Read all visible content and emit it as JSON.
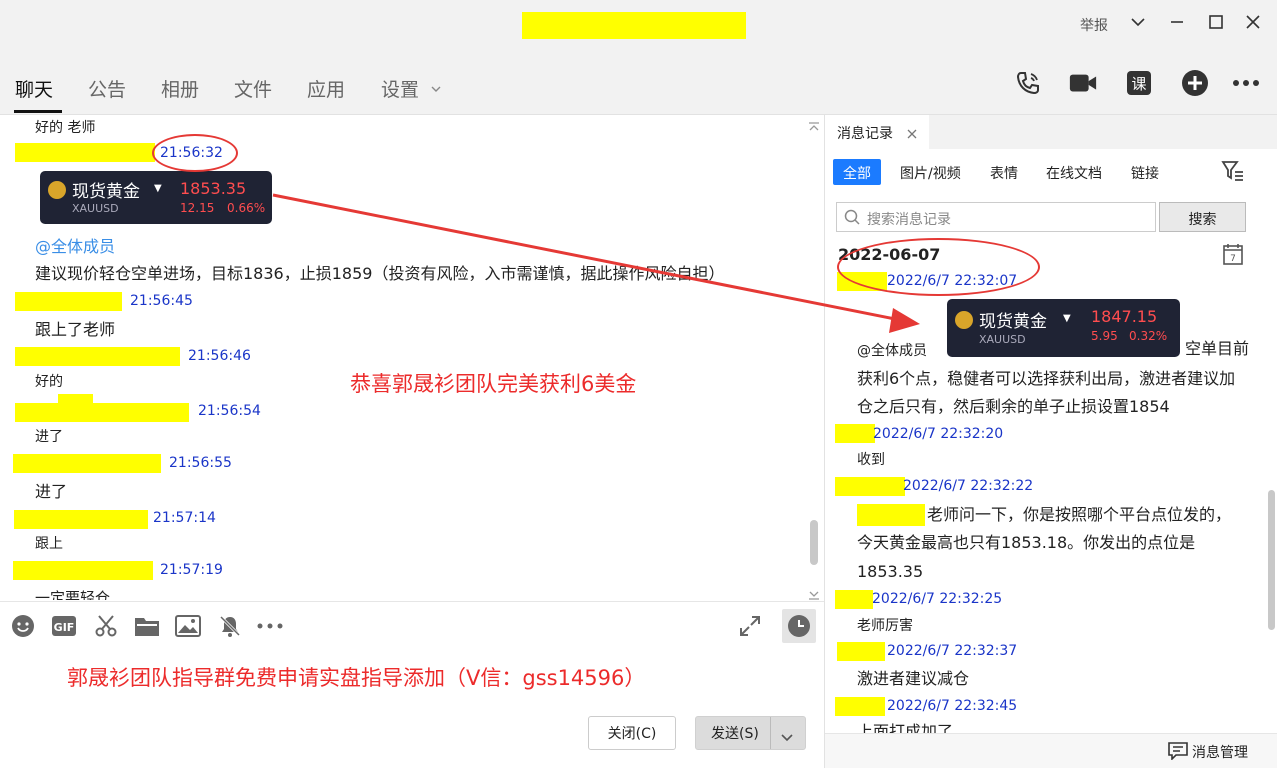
{
  "window": {
    "report_label": "举报"
  },
  "tabs": [
    {
      "label": "聊天"
    },
    {
      "label": "公告"
    },
    {
      "label": "相册"
    },
    {
      "label": "文件"
    },
    {
      "label": "应用"
    },
    {
      "label": "设置"
    }
  ],
  "toolbar": {
    "course_label": "课"
  },
  "chat": {
    "messages": [
      {
        "text": "好的  老师",
        "time": "21:56:32"
      },
      {
        "at": "@全体成员",
        "text": " 建议现价轻仓空单进场，目标1836，止损1859（投资有风险，入市需谨慎，据此操作风险自担）",
        "time": "21:56:45"
      },
      {
        "text": "跟上了老师",
        "time": "21:56:46"
      },
      {
        "text": "好的",
        "time": "21:56:54"
      },
      {
        "text": "进了",
        "time": "21:56:55"
      },
      {
        "text": "进了",
        "time": "21:57:14"
      },
      {
        "text": "跟上",
        "time": "21:57:19"
      },
      {
        "text": "一定要轻仓"
      }
    ],
    "card": {
      "name": "现货黄金",
      "symbol": "XAUUSD",
      "price": "1853.35",
      "change": "12.15",
      "percent": "0.66%"
    },
    "banner": "恭喜郭晟衫团队完美获利6美金"
  },
  "input": {
    "promo": "郭晟衫团队指导群免费申请实盘指导添加（V信：gss14596）",
    "close_label": "关闭(C)",
    "send_label": "发送(S)"
  },
  "history": {
    "tab_label": "消息记录",
    "filters": [
      "全部",
      "图片/视频",
      "表情",
      "在线文档",
      "链接"
    ],
    "search_placeholder": "搜索消息记录",
    "search_button": "搜索",
    "date": "2022-06-07",
    "card": {
      "name": "现货黄金",
      "symbol": "XAUUSD",
      "price": "1847.15",
      "change": "5.95",
      "percent": "0.32%"
    },
    "entries": [
      {
        "time": "2022/6/7 22:32:07"
      },
      {
        "at": "@全体成员",
        "text1": "空单目前",
        "text2": "获利6个点，稳健者可以选择获利出局，激进者建议加",
        "text3": "仓之后只有，然后剩余的单子止损设置1854"
      },
      {
        "time": "2022/6/7 22:32:20",
        "text": "收到"
      },
      {
        "time": "2022/6/7 22:32:22",
        "text1": "老师问一下，你是按照哪个平台点位发的，",
        "text2": "今天黄金最高也只有1853.18。你发出的点位是",
        "text3": "1853.35"
      },
      {
        "time": "2022/6/7 22:32:25",
        "text": "老师厉害"
      },
      {
        "time": "2022/6/7 22:32:37",
        "text": "激进者建议减仓"
      },
      {
        "time": "2022/6/7 22:32:45",
        "text": "上面打成加了"
      }
    ],
    "manage_label": "消息管理"
  },
  "colors": {
    "accent": "#1b7bff",
    "time_blue": "#1a35c8",
    "annotation_red": "#ec2b2b",
    "mask_yellow": "#ffff00"
  }
}
